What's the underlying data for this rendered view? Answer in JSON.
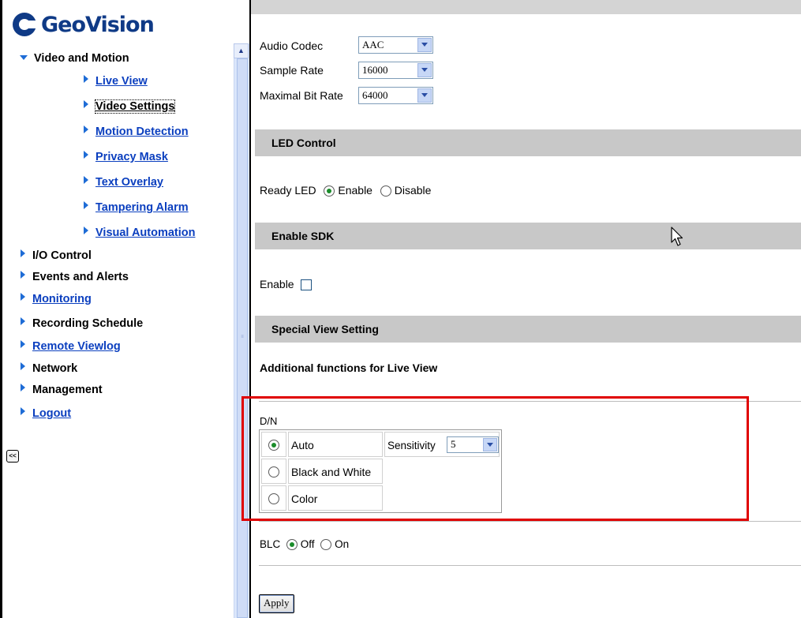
{
  "brand": {
    "logo_text": "GeoVision"
  },
  "sidebar": {
    "video_and_motion": "Video and Motion",
    "sub_items": [
      {
        "label": "Live View"
      },
      {
        "label": "Video Settings"
      },
      {
        "label": "Motion Detection"
      },
      {
        "label": "Privacy Mask"
      },
      {
        "label": "Text Overlay"
      },
      {
        "label": "Tampering Alarm"
      },
      {
        "label": "Visual Automation"
      }
    ],
    "items": [
      {
        "label": "I/O Control"
      },
      {
        "label": "Events and Alerts"
      },
      {
        "label": "Monitoring"
      },
      {
        "label": "Recording Schedule"
      },
      {
        "label": "Remote Viewlog"
      },
      {
        "label": "Network"
      },
      {
        "label": "Management"
      },
      {
        "label": "Logout"
      }
    ],
    "collapse_label": "<<",
    "scroll_up_glyph": "▲",
    "grip_glyph": "≡"
  },
  "audio": {
    "codec_label": "Audio Codec",
    "codec_value": "AAC",
    "sample_rate_label": "Sample Rate",
    "sample_rate_value": "16000",
    "bitrate_label": "Maximal Bit Rate",
    "bitrate_value": "64000"
  },
  "led": {
    "title": "LED Control",
    "ready_led_label": "Ready LED",
    "enable": "Enable",
    "disable": "Disable",
    "selected": "Enable"
  },
  "sdk": {
    "title": "Enable SDK",
    "enable_label": "Enable",
    "checked": false
  },
  "special_view": {
    "title": "Special View Setting",
    "subtitle": "Additional functions for Live View",
    "dn_label": "D/N",
    "options": [
      "Auto",
      "Black and White",
      "Color"
    ],
    "selected": "Auto",
    "sensitivity_label": "Sensitivity",
    "sensitivity_value": "5"
  },
  "blc": {
    "label": "BLC",
    "off": "Off",
    "on": "On",
    "selected": "Off"
  },
  "apply_label": "Apply",
  "colors": {
    "highlight_box": "#e00000",
    "section_bg": "#c8c8c8",
    "link": "#0b3fbf",
    "brand": "#0f3a86"
  }
}
